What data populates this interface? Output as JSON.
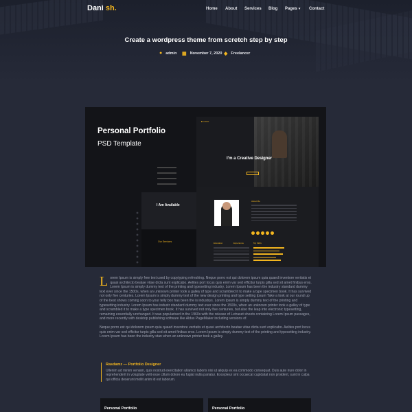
{
  "brand": {
    "name_main": "Dani",
    "name_accent": " sh."
  },
  "nav": {
    "items": [
      "Home",
      "About",
      "Services",
      "Blog",
      "Pages",
      "Contact"
    ],
    "pages_caret": "▾"
  },
  "post": {
    "title": "Create a wordpress theme from scretch step by step",
    "author": "admin",
    "date": "November 7, 2020",
    "category": "Freelancer"
  },
  "featured_image": {
    "title_line1": "Personal Portfolio",
    "title_line2": "PSD Template",
    "available_text": "I Am Available",
    "our_services": "Our Services",
    "creative": "I'm a Creative Designer",
    "about_me": "About Me",
    "education": "Education",
    "experience": "Experience",
    "my_skills": "My Skills"
  },
  "body": {
    "dropcap": "L",
    "paragraph1": "orem Ipsum is simply free text used by copytyping refreshing. Neque porro est qui dolorem ipsum quia quaed inventore veritatis et quasi architecto beatae vitae dicta sunt explicabo. Aelites port locus quis enim var sed efficitur turpis gilla sed sit amet finibus eros. Lorem Ipsum is simply dummy text of the printing and typesetting industry. Lorem Ipsum has been the industry standard dummy text ever since the 1500s, when an unknown printer took a galley of type and scrambled it to make a type specimen book. It has survived not only five centuries. Lorem Ipsum is simply dummy text of the new design printing and type setting Ipsum Take a look at our round up of the best shows coming soon to your telly box has been the is industrys. Lorem Ipsum is simply dummy text of the printing and typesetting industry. Lorem Ipsum has industr standard dummy text ever since the 1500s, when an unknown printer took a galley of type and scrambled it to make a type specimen book. It has survived not only five centuries, but also the leap into electronic typesetting, remaining essentially unchanged. It was popularised in the 1960s with the release of Letraset sheets containing Lorem Ipsum passages, and more recently with desktop publishing software like Aldus PageMaker including versions of.",
    "paragraph2": "Neque porro est qui dolorem ipsum quia quaed inventore veritatis et quasi architecto beatae vitae dicta sunt explicabo. Aelites port locus quis enim var sed efficitur turpis gilla sed sit amet finibus eros. Lorem Ipsum is simply dummy text of the printing and typesetting industry. Lorem Ipsum has been the industry stan when an unknown printer took a galley."
  },
  "quote": {
    "title": "Rasdamz — Portfolio Designer",
    "text": "Ullenim ad minim veniam, quis nostrud exercitation ullamco laboris nisi ut aliquip ex ea commodo consequat. Duis aute irure dolor in reprehenderit in voluptate velit esse cillum dolore eu fugiat nulla pariatur. Excepteur sint occaecat cupidatat non proident, sunt in culpa qui officia deserunt mollit anim id est laborum."
  },
  "cards": [
    {
      "title": "Personal Portfolio"
    },
    {
      "title": "Personal Portfolio"
    }
  ],
  "colors": {
    "accent": "#f3b61f",
    "background": "#262a38"
  },
  "icons": {
    "author": "user-icon",
    "date": "calendar-icon",
    "category": "tag-icon"
  }
}
